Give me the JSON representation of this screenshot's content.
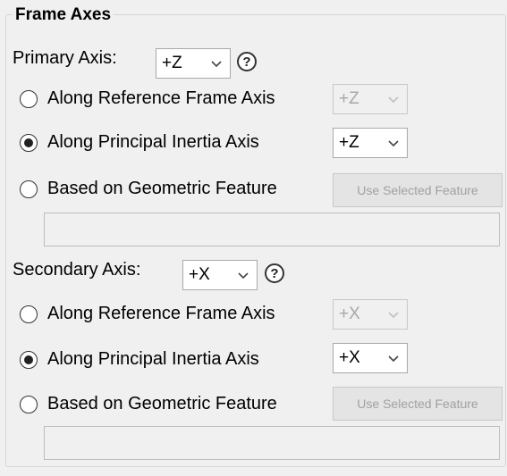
{
  "group": {
    "title": "Frame Axes"
  },
  "primary": {
    "label": "Primary Axis:",
    "value": "+Z",
    "help": "?",
    "options": {
      "reference": {
        "label": "Along Reference Frame Axis",
        "value": "+Z",
        "checked": false
      },
      "principal": {
        "label": "Along Principal Inertia Axis",
        "value": "+Z",
        "checked": true
      },
      "geometric": {
        "label": "Based on Geometric Feature",
        "button": "Use Selected Feature",
        "checked": false
      }
    }
  },
  "secondary": {
    "label": "Secondary Axis:",
    "value": "+X",
    "help": "?",
    "options": {
      "reference": {
        "label": "Along Reference Frame Axis",
        "value": "+X",
        "checked": false
      },
      "principal": {
        "label": "Along Principal Inertia Axis",
        "value": "+X",
        "checked": true
      },
      "geometric": {
        "label": "Based on Geometric Feature",
        "button": "Use Selected Feature",
        "checked": false
      }
    }
  },
  "icons": {
    "dropdown": "chevron-down-icon",
    "help": "help-icon"
  }
}
